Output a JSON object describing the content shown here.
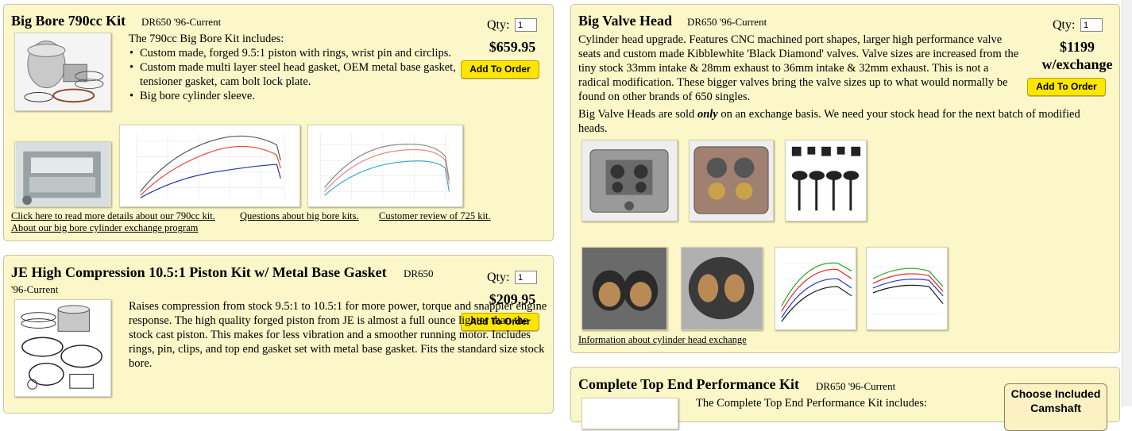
{
  "colors": {
    "card_bg": "#fcf7c9",
    "card_border": "#c9c2a0",
    "button_bg": "#ffe600"
  },
  "big_bore": {
    "title": "Big Bore 790cc Kit",
    "model": "DR650 '96-Current",
    "qty_label": "Qty:",
    "qty_value": "1",
    "price": "$659.95",
    "button": "Add To Order",
    "intro": "The 790cc Big Bore Kit includes:",
    "bullets": [
      "Custom made, forged 9.5:1 piston with rings, wrist pin and circlips.",
      "Custom made multi layer steel head gasket, OEM metal base gasket, tensioner gasket, cam bolt lock plate.",
      "Big bore cylinder sleeve."
    ],
    "links": [
      "Click here to read more details about our 790cc kit.",
      "Questions about big bore kits.",
      "Customer review of 725 kit.",
      "About our big bore cylinder exchange program"
    ],
    "images": [
      "piston-kit-photo",
      "cylinder-sleeve-photo",
      "dyno-chart-1",
      "dyno-chart-2"
    ]
  },
  "je_piston": {
    "title": "JE High Compression 10.5:1 Piston Kit w/ Metal Base Gasket",
    "model_a": "DR650",
    "model_b": "'96-Current",
    "qty_label": "Qty:",
    "qty_value": "1",
    "price": "$209.95",
    "button": "Add To Order",
    "description": "Raises compression from stock 9.5:1 to 10.5:1 for more power, torque and snappier engine response. The high quality forged piston from JE is almost a full ounce lighter than the stock cast piston. This makes for less vibration and a smoother running motor. Includes rings, pin, clips, and top end gasket set with metal base gasket. Fits the standard size stock bore."
  },
  "big_valve": {
    "title": "Big Valve Head",
    "model": "DR650 '96-Current",
    "qty_label": "Qty:",
    "qty_value": "1",
    "price_line1": "$1199",
    "price_line2": "w/exchange",
    "button": "Add To Order",
    "description": "Cylinder head upgrade. Features CNC machined port shapes, larger high performance valve seats and custom made Kibblewhite 'Black Diamond' valves. Valve sizes are increased from the tiny stock 33mm intake & 28mm exhaust to 36mm intake & 32mm exhaust. This is not a radical modification. These bigger valves bring the valve sizes up to what would normally be found on other brands of 650 singles.",
    "exchange_pre": "Big Valve Heads are sold ",
    "exchange_emph": "only",
    "exchange_post": " on an exchange basis. We need your stock head for the next batch of modified heads.",
    "link": "Information about cylinder head exchange",
    "images": [
      "head-top-photo",
      "head-valves-photo",
      "valves-photo",
      "intake-port-photo",
      "exhaust-port-photo",
      "dyno-chart-3",
      "dyno-chart-4"
    ]
  },
  "top_end": {
    "title": "Complete Top End Performance Kit",
    "model": "DR650 '96-Current",
    "intro": "The Complete Top End Performance Kit includes:",
    "choose_button_line1": "Choose Included",
    "choose_button_line2": "Camshaft"
  }
}
